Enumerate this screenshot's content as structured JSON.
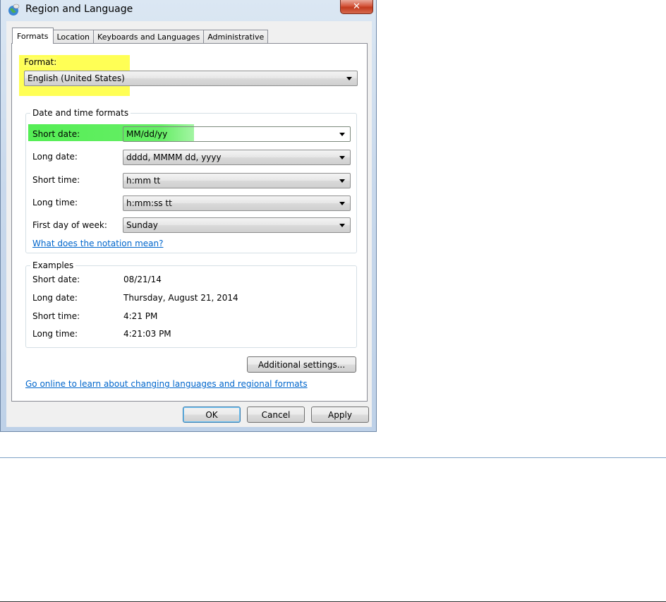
{
  "window": {
    "title": "Region and Language",
    "close_label": "✕"
  },
  "tabs": [
    {
      "label": "Formats",
      "active": true
    },
    {
      "label": "Location",
      "active": false
    },
    {
      "label": "Keyboards and Languages",
      "active": false
    },
    {
      "label": "Administrative",
      "active": false
    }
  ],
  "format": {
    "label": "Format:",
    "value": "English (United States)"
  },
  "date_time_formats": {
    "title": "Date and time formats",
    "short_date": {
      "label": "Short date:",
      "value": "MM/dd/yy"
    },
    "long_date": {
      "label": "Long date:",
      "value": "dddd, MMMM dd, yyyy"
    },
    "short_time": {
      "label": "Short time:",
      "value": "h:mm tt"
    },
    "long_time": {
      "label": "Long time:",
      "value": "h:mm:ss tt"
    },
    "first_day": {
      "label": "First day of week:",
      "value": "Sunday"
    },
    "notation_link": "What does the notation mean?"
  },
  "examples": {
    "title": "Examples",
    "short_date": {
      "label": "Short date:",
      "value": "08/21/14"
    },
    "long_date": {
      "label": "Long date:",
      "value": "Thursday, August 21, 2014"
    },
    "short_time": {
      "label": "Short time:",
      "value": "4:21 PM"
    },
    "long_time": {
      "label": "Long time:",
      "value": "4:21:03 PM"
    }
  },
  "additional_settings_label": "Additional settings...",
  "online_link": "Go online to learn about changing languages and regional formats",
  "buttons": {
    "ok": "OK",
    "cancel": "Cancel",
    "apply": "Apply"
  },
  "colors": {
    "highlight_yellow": "#ffff55",
    "highlight_green": "#55ee55",
    "link": "#0066cc"
  }
}
